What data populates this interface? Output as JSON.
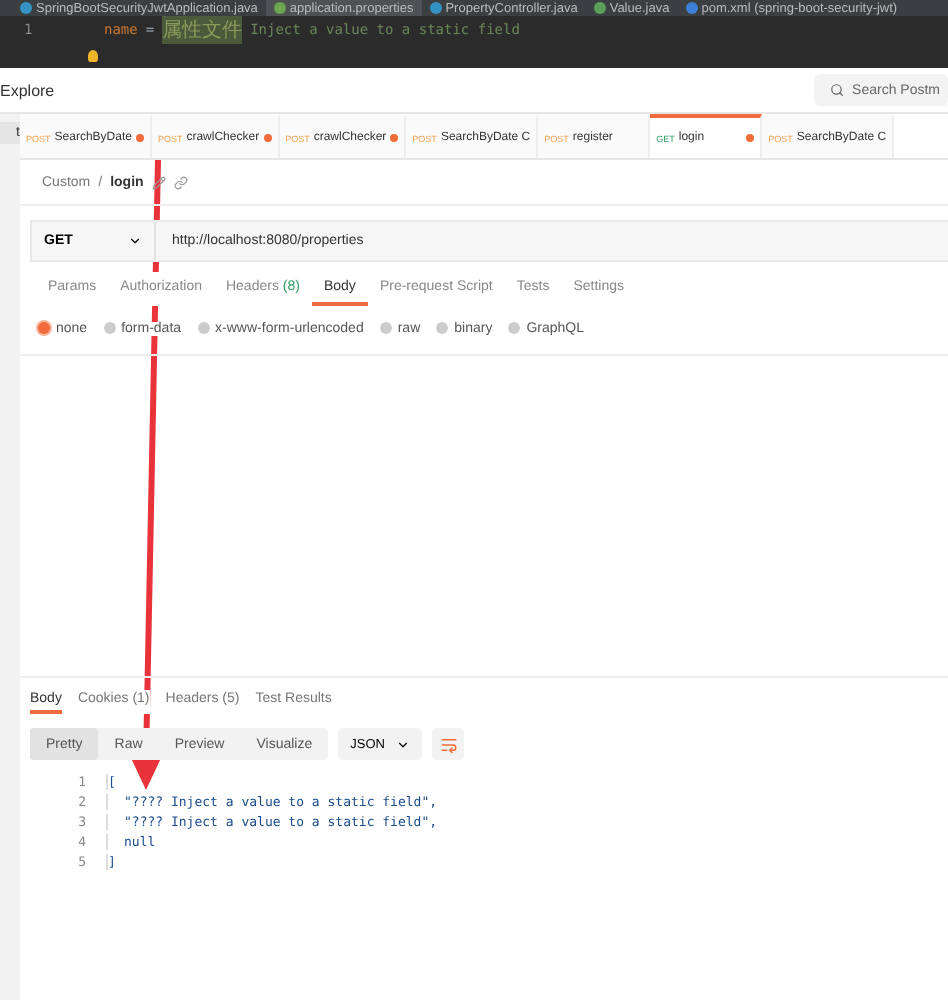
{
  "ide": {
    "tabs": [
      {
        "label": "SpringBootSecurityJwtApplication.java",
        "kind": "class",
        "selected": false
      },
      {
        "label": "application.properties",
        "kind": "properties",
        "selected": true
      },
      {
        "label": "PropertyController.java",
        "kind": "class",
        "selected": false
      },
      {
        "label": "Value.java",
        "kind": "annotation",
        "selected": false
      },
      {
        "label": "pom.xml (spring-boot-security-jwt)",
        "kind": "maven",
        "selected": false
      }
    ],
    "line_number": "1",
    "code": {
      "key": "name",
      "equals": "=",
      "value": "属性文件",
      "comment": "Inject a value to a static field"
    }
  },
  "sidebar": {
    "button": "t"
  },
  "header": {
    "title": "Explore",
    "search": {
      "placeholder": "Search Postm"
    }
  },
  "request_tabs": [
    {
      "method": "POST",
      "name": "SearchByDate",
      "dirty": true,
      "selected": false
    },
    {
      "method": "POST",
      "name": "crawlChecker",
      "dirty": true,
      "selected": false
    },
    {
      "method": "POST",
      "name": "crawlChecker",
      "dirty": true,
      "selected": false
    },
    {
      "method": "POST",
      "name": "SearchByDate C",
      "dirty": false,
      "selected": false
    },
    {
      "method": "POST",
      "name": "register",
      "dirty": false,
      "selected": false
    },
    {
      "method": "GET",
      "name": "login",
      "dirty": true,
      "selected": true
    },
    {
      "method": "POST",
      "name": "SearchByDate C",
      "dirty": false,
      "selected": false
    }
  ],
  "breadcrumb": {
    "parent": "Custom",
    "separator": "/",
    "current": "login"
  },
  "request": {
    "method": "GET",
    "url": "http://localhost:8080/properties"
  },
  "request_sections": [
    {
      "label": "Params",
      "selected": false
    },
    {
      "label": "Authorization",
      "selected": false
    },
    {
      "label": "Headers",
      "count": "(8)",
      "selected": false
    },
    {
      "label": "Body",
      "selected": true
    },
    {
      "label": "Pre-request Script",
      "selected": false
    },
    {
      "label": "Tests",
      "selected": false
    },
    {
      "label": "Settings",
      "selected": false
    }
  ],
  "body_types": [
    {
      "label": "none",
      "selected": true
    },
    {
      "label": "form-data",
      "selected": false
    },
    {
      "label": "x-www-form-urlencoded",
      "selected": false
    },
    {
      "label": "raw",
      "selected": false
    },
    {
      "label": "binary",
      "selected": false
    },
    {
      "label": "GraphQL",
      "selected": false
    }
  ],
  "response": {
    "tabs": [
      {
        "label": "Body",
        "selected": true
      },
      {
        "label": "Cookies (1)",
        "selected": false
      },
      {
        "label": "Headers (5)",
        "selected": false
      },
      {
        "label": "Test Results",
        "selected": false
      }
    ],
    "views": [
      {
        "label": "Pretty",
        "selected": true
      },
      {
        "label": "Raw",
        "selected": false
      },
      {
        "label": "Preview",
        "selected": false
      },
      {
        "label": "Visualize",
        "selected": false
      }
    ],
    "format": "JSON",
    "lines": [
      {
        "number": "1",
        "text": "["
      },
      {
        "number": "2",
        "text": "\"???? Inject a value to a static field\","
      },
      {
        "number": "3",
        "text": "\"???? Inject a value to a static field\","
      },
      {
        "number": "4",
        "text": "null"
      },
      {
        "number": "5",
        "text": "]"
      }
    ]
  }
}
